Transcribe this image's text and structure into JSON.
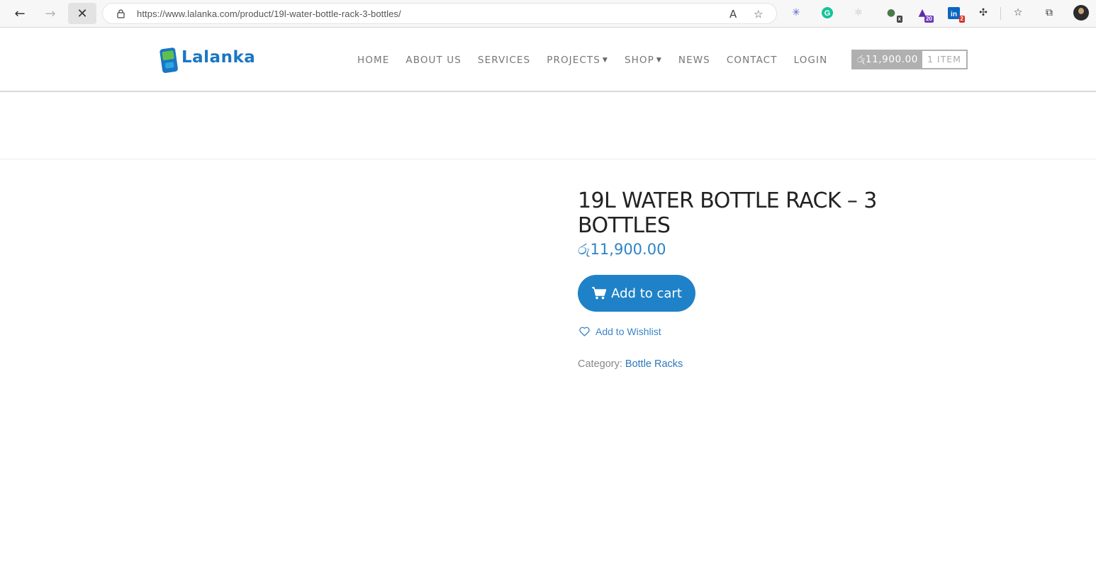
{
  "browser": {
    "url": "https://www.lalanka.com/product/19l-water-bottle-rack-3-bottles/",
    "extensions": [
      {
        "name": "ai-assistant-icon",
        "badge": ""
      },
      {
        "name": "grammarly-icon",
        "badge": ""
      },
      {
        "name": "react-devtools-icon",
        "badge": ""
      },
      {
        "name": "notes-extension-icon",
        "badge": "x"
      },
      {
        "name": "scholar-extension-icon",
        "badge": "20"
      },
      {
        "name": "linkedin-icon",
        "badge": "2"
      }
    ],
    "colors": {
      "scholar_badge": "#6b38b8",
      "linkedin_badge": "#d93025",
      "linkedin": "#0a66c2",
      "grammarly": "#15c39a"
    }
  },
  "site": {
    "logo_text": "Lalanka",
    "menu": [
      {
        "label": "HOME",
        "has_dropdown": false
      },
      {
        "label": "ABOUT US",
        "has_dropdown": false
      },
      {
        "label": "SERVICES",
        "has_dropdown": false
      },
      {
        "label": "PROJECTS",
        "has_dropdown": true
      },
      {
        "label": "SHOP",
        "has_dropdown": true
      },
      {
        "label": "NEWS",
        "has_dropdown": false
      },
      {
        "label": "CONTACT",
        "has_dropdown": false
      },
      {
        "label": "LOGIN",
        "has_dropdown": false
      }
    ],
    "cart": {
      "total": "රු11,900.00",
      "count": "1 ITEM"
    }
  },
  "product": {
    "title": "19L WATER BOTTLE RACK – 3 BOTTLES",
    "price": "රු11,900.00",
    "add_to_cart_label": "Add to cart",
    "wishlist_label": "Add to Wishlist",
    "category_prefix": "Category:",
    "category_name": "Bottle Racks"
  },
  "colors": {
    "accent": "#1f82c8",
    "link": "#2d78bd"
  }
}
